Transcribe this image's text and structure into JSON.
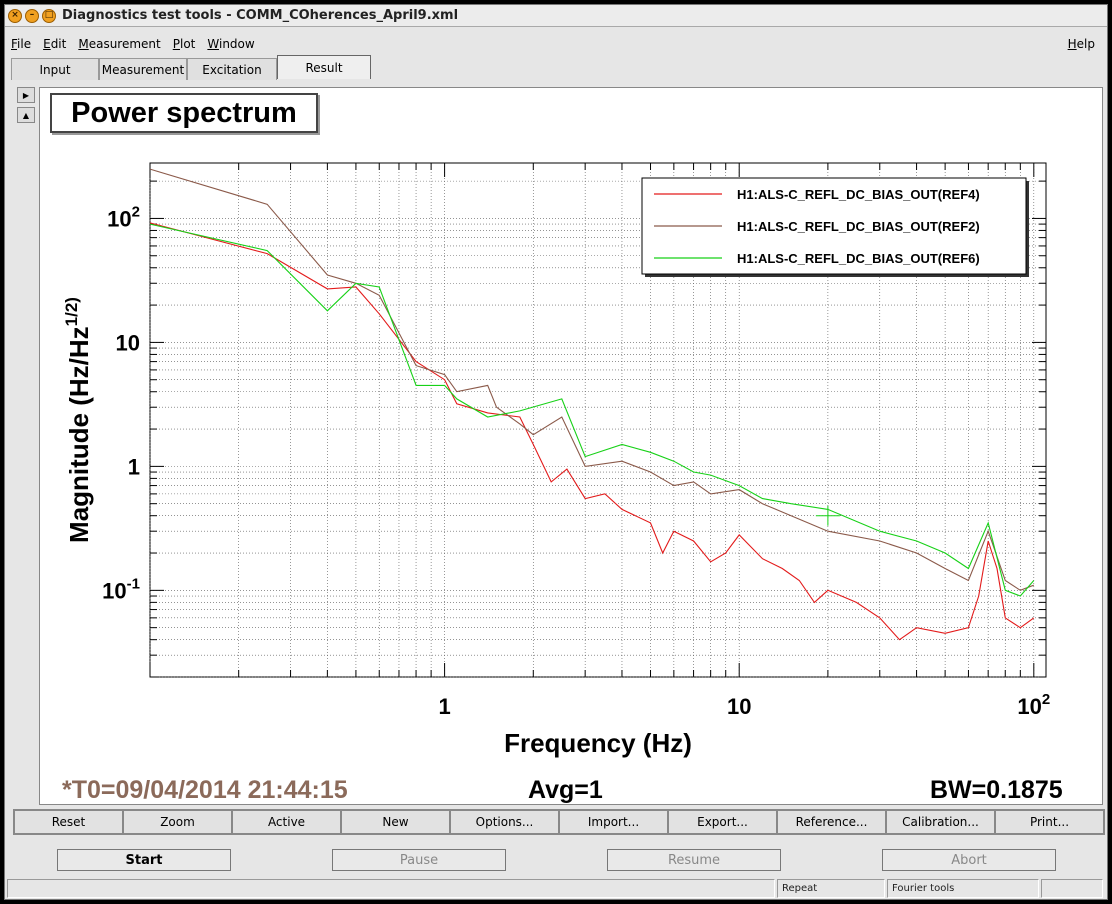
{
  "window": {
    "title": "Diagnostics test tools - COMM_COherences_April9.xml"
  },
  "menu": {
    "file": {
      "u": "F",
      "rest": "ile"
    },
    "edit": {
      "u": "E",
      "rest": "dit"
    },
    "measurement": {
      "u": "M",
      "rest": "easurement"
    },
    "plot": {
      "u": "P",
      "rest": "lot"
    },
    "window": {
      "u": "W",
      "rest": "indow"
    },
    "help": {
      "u": "H",
      "rest": "elp"
    }
  },
  "tabs": [
    {
      "label": "Input"
    },
    {
      "label": "Measurement"
    },
    {
      "label": "Excitation"
    },
    {
      "label": "Result",
      "active": true
    }
  ],
  "plot": {
    "panel_title": "Power spectrum",
    "footer": {
      "t0": "*T0=09/04/2014 21:44:15",
      "avg": "Avg=1",
      "bw": "BW=0.1875"
    }
  },
  "colors": {
    "ref4": "#e31b1b",
    "ref2": "#8b5a4a",
    "ref6": "#17d117",
    "t0": "#8b6a5a"
  },
  "chart_data": {
    "type": "line",
    "title": "",
    "xlabel": "Frequency (Hz)",
    "ylabel": "Magnitude (Hz/Hz^(1/2))",
    "xscale": "log",
    "yscale": "log",
    "xlim": [
      0.1,
      110
    ],
    "ylim": [
      0.02,
      280
    ],
    "x_ticks": [
      "1",
      "10",
      "10^2"
    ],
    "y_ticks": [
      "10^-1",
      "1",
      "10",
      "10^2"
    ],
    "grid": true,
    "legend": "top-right",
    "series": [
      {
        "name": "H1:ALS-C_REFL_DC_BIAS_OUT(REF4)",
        "color": "#e31b1b",
        "points": [
          [
            0.1,
            92
          ],
          [
            0.25,
            52
          ],
          [
            0.4,
            27
          ],
          [
            0.5,
            28
          ],
          [
            0.6,
            17
          ],
          [
            0.8,
            7
          ],
          [
            1,
            5
          ],
          [
            1.1,
            3.2
          ],
          [
            1.4,
            2.7
          ],
          [
            1.8,
            2.5
          ],
          [
            2,
            1.5
          ],
          [
            2.3,
            0.75
          ],
          [
            2.6,
            0.95
          ],
          [
            3,
            0.55
          ],
          [
            3.5,
            0.6
          ],
          [
            4,
            0.45
          ],
          [
            5,
            0.35
          ],
          [
            5.5,
            0.2
          ],
          [
            6,
            0.3
          ],
          [
            7,
            0.25
          ],
          [
            8,
            0.17
          ],
          [
            9,
            0.2
          ],
          [
            10,
            0.28
          ],
          [
            12,
            0.18
          ],
          [
            14,
            0.15
          ],
          [
            16,
            0.12
          ],
          [
            18,
            0.08
          ],
          [
            20,
            0.1
          ],
          [
            25,
            0.08
          ],
          [
            30,
            0.06
          ],
          [
            35,
            0.04
          ],
          [
            40,
            0.05
          ],
          [
            50,
            0.045
          ],
          [
            60,
            0.05
          ],
          [
            65,
            0.09
          ],
          [
            70,
            0.25
          ],
          [
            75,
            0.15
          ],
          [
            80,
            0.06
          ],
          [
            90,
            0.05
          ],
          [
            100,
            0.06
          ]
        ]
      },
      {
        "name": "H1:ALS-C_REFL_DC_BIAS_OUT(REF2)",
        "color": "#8b5a4a",
        "points": [
          [
            0.1,
            250
          ],
          [
            0.25,
            130
          ],
          [
            0.4,
            35
          ],
          [
            0.5,
            30
          ],
          [
            0.6,
            24
          ],
          [
            0.8,
            6.5
          ],
          [
            1,
            5.5
          ],
          [
            1.1,
            4
          ],
          [
            1.4,
            4.5
          ],
          [
            1.5,
            3
          ],
          [
            1.8,
            2.2
          ],
          [
            2,
            1.8
          ],
          [
            2.5,
            2.5
          ],
          [
            3,
            1
          ],
          [
            4,
            1.1
          ],
          [
            5,
            0.9
          ],
          [
            6,
            0.7
          ],
          [
            7,
            0.75
          ],
          [
            8,
            0.6
          ],
          [
            10,
            0.65
          ],
          [
            12,
            0.5
          ],
          [
            15,
            0.4
          ],
          [
            20,
            0.3
          ],
          [
            30,
            0.25
          ],
          [
            40,
            0.2
          ],
          [
            50,
            0.15
          ],
          [
            60,
            0.12
          ],
          [
            70,
            0.3
          ],
          [
            80,
            0.12
          ],
          [
            90,
            0.1
          ],
          [
            100,
            0.11
          ]
        ]
      },
      {
        "name": "H1:ALS-C_REFL_DC_BIAS_OUT(REF6)",
        "color": "#17d117",
        "points": [
          [
            0.1,
            90
          ],
          [
            0.25,
            55
          ],
          [
            0.4,
            18
          ],
          [
            0.5,
            30
          ],
          [
            0.6,
            28
          ],
          [
            0.8,
            4.5
          ],
          [
            1,
            4.5
          ],
          [
            1.1,
            3.5
          ],
          [
            1.4,
            2.5
          ],
          [
            1.8,
            2.8
          ],
          [
            2.5,
            3.5
          ],
          [
            3,
            1.2
          ],
          [
            4,
            1.5
          ],
          [
            5,
            1.3
          ],
          [
            6,
            1.1
          ],
          [
            7,
            0.9
          ],
          [
            8,
            0.85
          ],
          [
            10,
            0.7
          ],
          [
            12,
            0.55
          ],
          [
            15,
            0.5
          ],
          [
            20,
            0.45
          ],
          [
            30,
            0.3
          ],
          [
            40,
            0.25
          ],
          [
            50,
            0.2
          ],
          [
            60,
            0.15
          ],
          [
            70,
            0.35
          ],
          [
            80,
            0.1
          ],
          [
            90,
            0.09
          ],
          [
            100,
            0.12
          ]
        ]
      }
    ]
  },
  "buttons": {
    "reset": "Reset",
    "zoom": "Zoom",
    "active": "Active",
    "new": "New",
    "options": "Options...",
    "import": "Import...",
    "export": "Export...",
    "reference": "Reference...",
    "calibration": "Calibration...",
    "print": "Print..."
  },
  "controls": {
    "start": "Start",
    "pause": "Pause",
    "resume": "Resume",
    "abort": "Abort"
  },
  "status": {
    "repeat": "Repeat",
    "fourier": "Fourier tools"
  },
  "icons": {
    "close": "close-icon",
    "minimize": "minimize-icon",
    "maximize": "maximize-icon",
    "side_right": "triangle-right-icon",
    "side_up": "triangle-up-icon"
  }
}
